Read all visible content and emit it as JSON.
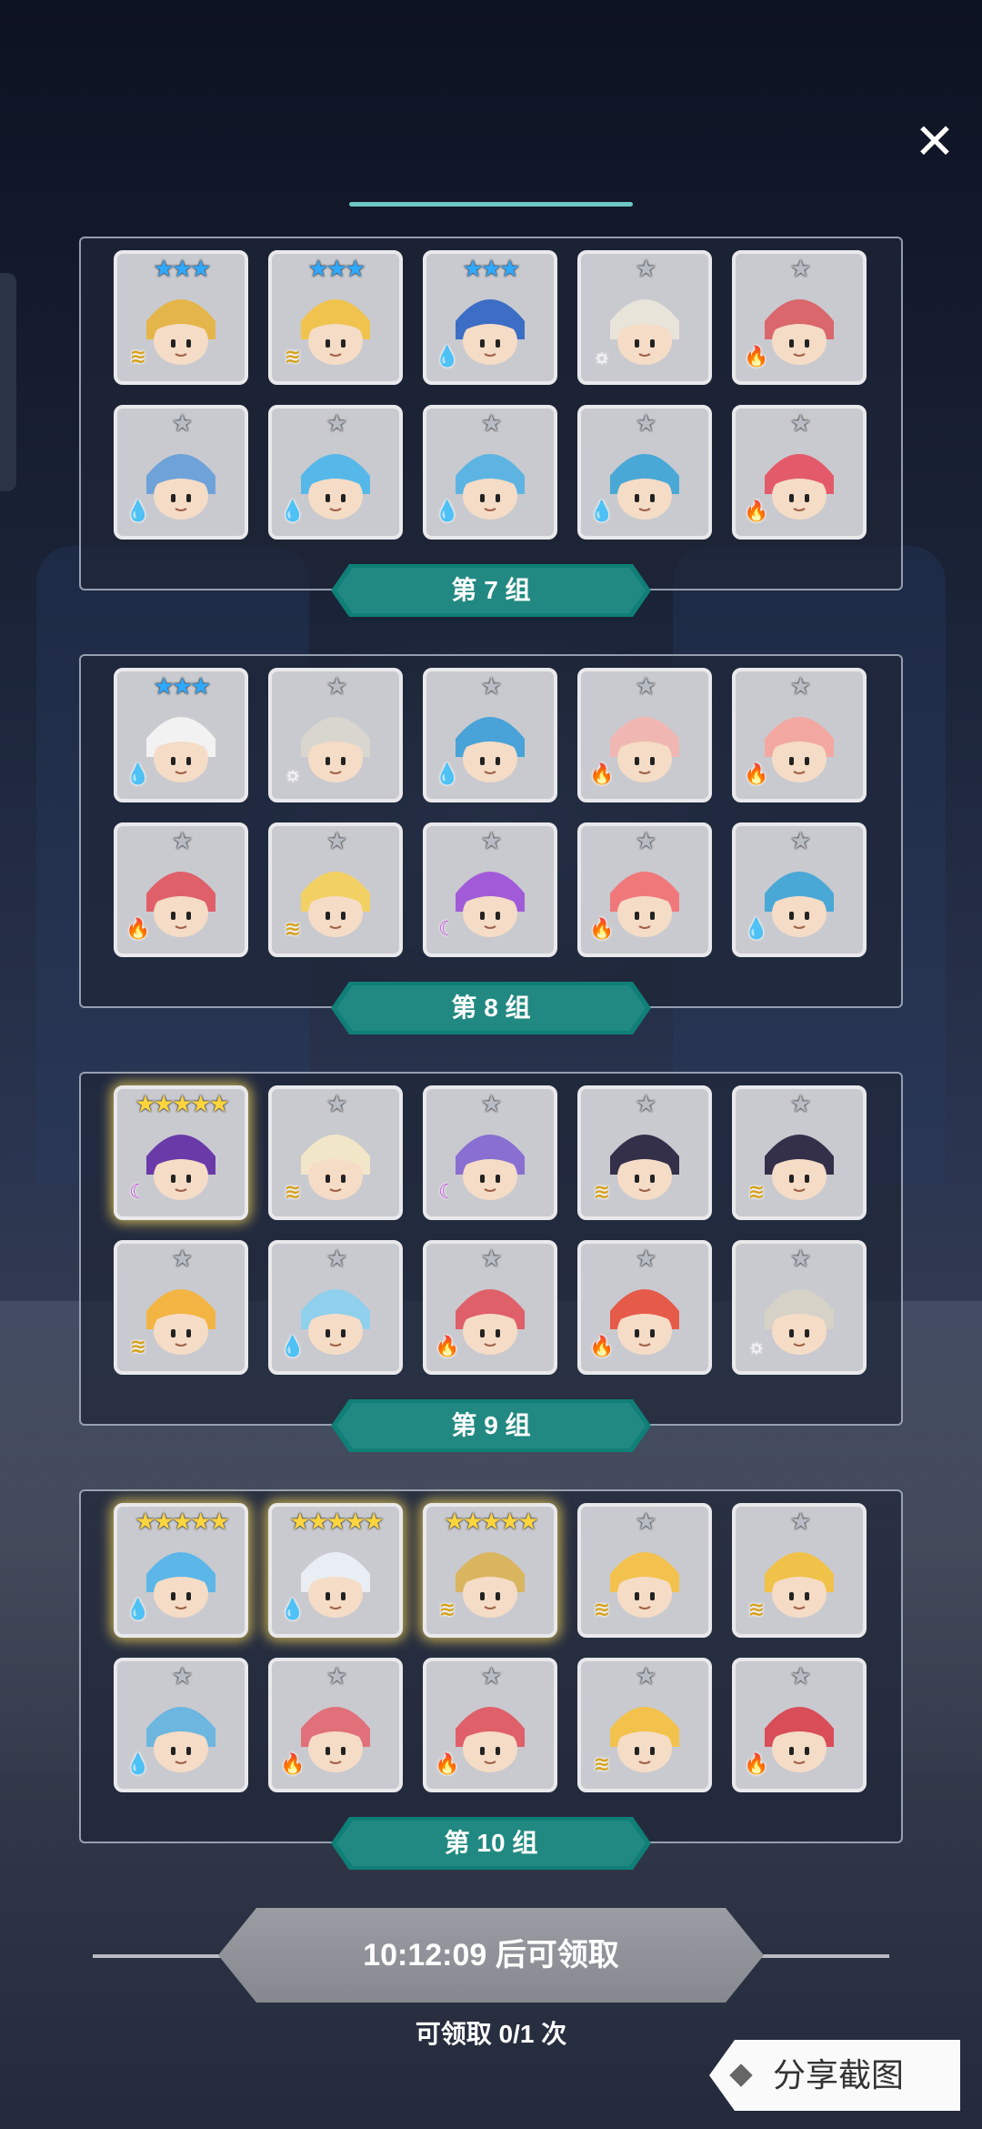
{
  "close_label": "✕",
  "groups": [
    {
      "label": "第 7 组",
      "rows": [
        [
          {
            "stars": "★★★",
            "star_color": "#2fa8ff",
            "element": "wind",
            "rare": false,
            "hue": "#e4b54a"
          },
          {
            "stars": "★★★",
            "star_color": "#2fa8ff",
            "element": "wind",
            "rare": false,
            "hue": "#f0c34e"
          },
          {
            "stars": "★★★",
            "star_color": "#2fa8ff",
            "element": "water",
            "rare": false,
            "hue": "#3b6ec4"
          },
          {
            "stars": "★",
            "star_color": "#b8bcc4",
            "element": "light",
            "rare": false,
            "hue": "#e8e4da"
          },
          {
            "stars": "★",
            "star_color": "#b8bcc4",
            "element": "fire",
            "rare": false,
            "hue": "#d9676b"
          }
        ],
        [
          {
            "stars": "★",
            "star_color": "#b8bcc4",
            "element": "water",
            "rare": false,
            "hue": "#6ea2d8"
          },
          {
            "stars": "★",
            "star_color": "#b8bcc4",
            "element": "water",
            "rare": false,
            "hue": "#56b8e8"
          },
          {
            "stars": "★",
            "star_color": "#b8bcc4",
            "element": "water",
            "rare": false,
            "hue": "#5db4e2"
          },
          {
            "stars": "★",
            "star_color": "#b8bcc4",
            "element": "water",
            "rare": false,
            "hue": "#4aa8d6"
          },
          {
            "stars": "★",
            "star_color": "#b8bcc4",
            "element": "fire",
            "rare": false,
            "hue": "#e35b6a"
          }
        ]
      ]
    },
    {
      "label": "第 8 组",
      "rows": [
        [
          {
            "stars": "★★★",
            "star_color": "#2fa8ff",
            "element": "water",
            "rare": false,
            "hue": "#f2f2f2"
          },
          {
            "stars": "★",
            "star_color": "#b8bcc4",
            "element": "light",
            "rare": false,
            "hue": "#d9d6d0"
          },
          {
            "stars": "★",
            "star_color": "#b8bcc4",
            "element": "water",
            "rare": false,
            "hue": "#49a3d8"
          },
          {
            "stars": "★",
            "star_color": "#b8bcc4",
            "element": "fire",
            "rare": false,
            "hue": "#f0b7b2"
          },
          {
            "stars": "★",
            "star_color": "#b8bcc4",
            "element": "fire",
            "rare": false,
            "hue": "#f2a8a0"
          }
        ],
        [
          {
            "stars": "★",
            "star_color": "#b8bcc4",
            "element": "fire",
            "rare": false,
            "hue": "#e0606a"
          },
          {
            "stars": "★",
            "star_color": "#b8bcc4",
            "element": "wind",
            "rare": false,
            "hue": "#f3d064"
          },
          {
            "stars": "★",
            "star_color": "#b8bcc4",
            "element": "dark",
            "rare": false,
            "hue": "#a25bd8"
          },
          {
            "stars": "★",
            "star_color": "#b8bcc4",
            "element": "fire",
            "rare": false,
            "hue": "#f0787a"
          },
          {
            "stars": "★",
            "star_color": "#b8bcc4",
            "element": "water",
            "rare": false,
            "hue": "#4aa8d6"
          }
        ]
      ]
    },
    {
      "label": "第 9 组",
      "rows": [
        [
          {
            "stars": "★★★★★",
            "star_color": "#ffd53d",
            "element": "dark",
            "rare": true,
            "hue": "#6a3aa8"
          },
          {
            "stars": "★",
            "star_color": "#b8bcc4",
            "element": "wind",
            "rare": false,
            "hue": "#f2e6c8"
          },
          {
            "stars": "★",
            "star_color": "#b8bcc4",
            "element": "dark",
            "rare": false,
            "hue": "#8a6fd2"
          },
          {
            "stars": "★",
            "star_color": "#b8bcc4",
            "element": "wind",
            "rare": false,
            "hue": "#34304a"
          },
          {
            "stars": "★",
            "star_color": "#b8bcc4",
            "element": "wind",
            "rare": false,
            "hue": "#34304a"
          }
        ],
        [
          {
            "stars": "★",
            "star_color": "#b8bcc4",
            "element": "wind",
            "rare": false,
            "hue": "#f2b544"
          },
          {
            "stars": "★",
            "star_color": "#b8bcc4",
            "element": "water",
            "rare": false,
            "hue": "#8fd0ec"
          },
          {
            "stars": "★",
            "star_color": "#b8bcc4",
            "element": "fire",
            "rare": false,
            "hue": "#e0606a"
          },
          {
            "stars": "★",
            "star_color": "#b8bcc4",
            "element": "fire",
            "rare": false,
            "hue": "#e65a4a"
          },
          {
            "stars": "★",
            "star_color": "#b8bcc4",
            "element": "light",
            "rare": false,
            "hue": "#d6d2c8"
          }
        ]
      ]
    },
    {
      "label": "第 10 组",
      "rows": [
        [
          {
            "stars": "★★★★★",
            "star_color": "#ffd53d",
            "element": "water",
            "rare": true,
            "hue": "#5cb7e8"
          },
          {
            "stars": "★★★★★",
            "star_color": "#ffd53d",
            "element": "water",
            "rare": true,
            "hue": "#e8eef4"
          },
          {
            "stars": "★★★★★",
            "star_color": "#ffd53d",
            "element": "wind",
            "rare": true,
            "hue": "#d9b560"
          },
          {
            "stars": "★",
            "star_color": "#b8bcc4",
            "element": "wind",
            "rare": false,
            "hue": "#f3c24e"
          },
          {
            "stars": "★",
            "star_color": "#b8bcc4",
            "element": "wind",
            "rare": false,
            "hue": "#f0c24a"
          }
        ],
        [
          {
            "stars": "★",
            "star_color": "#b8bcc4",
            "element": "water",
            "rare": false,
            "hue": "#6cb6e0"
          },
          {
            "stars": "★",
            "star_color": "#b8bcc4",
            "element": "fire",
            "rare": false,
            "hue": "#e0707a"
          },
          {
            "stars": "★",
            "star_color": "#b8bcc4",
            "element": "fire",
            "rare": false,
            "hue": "#e0606a"
          },
          {
            "stars": "★",
            "star_color": "#b8bcc4",
            "element": "wind",
            "rare": false,
            "hue": "#f2c24c"
          },
          {
            "stars": "★",
            "star_color": "#b8bcc4",
            "element": "fire",
            "rare": false,
            "hue": "#d94d58"
          }
        ]
      ]
    }
  ],
  "element_icons": {
    "wind": "≋",
    "water": "💧",
    "fire": "🔥",
    "light": "☼",
    "dark": "☾"
  },
  "element_colors": {
    "wind": "#d6a21e",
    "water": "#2d8fe0",
    "fire": "#e5402a",
    "light": "#ffffff",
    "dark": "#c04fd8"
  },
  "claim": {
    "label": "10:12:09 后可领取",
    "count": "可领取 0/1 次"
  },
  "share_label": "分享截图"
}
